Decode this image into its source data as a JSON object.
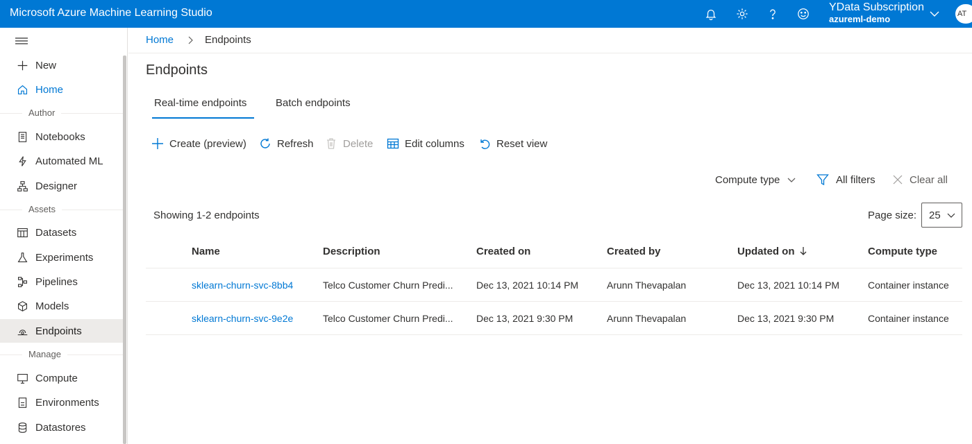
{
  "app": {
    "title": "Microsoft Azure Machine Learning Studio",
    "subscription": "YData Subscription",
    "workspace": "azureml-demo",
    "avatar_initials": "AT",
    "brand_color": "#0078d4"
  },
  "header_icons": [
    "bell-icon",
    "gear-icon",
    "help-icon",
    "smiley-icon"
  ],
  "sidebar": {
    "new_label": "New",
    "home_label": "Home",
    "sections": {
      "author": "Author",
      "assets": "Assets",
      "manage": "Manage"
    },
    "items": {
      "notebooks": "Notebooks",
      "automated_ml": "Automated ML",
      "designer": "Designer",
      "datasets": "Datasets",
      "experiments": "Experiments",
      "pipelines": "Pipelines",
      "models": "Models",
      "endpoints": "Endpoints",
      "compute": "Compute",
      "environments": "Environments",
      "datastores": "Datastores"
    },
    "active_item": "Endpoints"
  },
  "breadcrumb": {
    "home": "Home",
    "current": "Endpoints"
  },
  "page": {
    "title": "Endpoints",
    "tabs": {
      "realtime": "Real-time endpoints",
      "batch": "Batch endpoints"
    },
    "active_tab": "Real-time endpoints"
  },
  "toolbar": {
    "create": "Create (preview)",
    "refresh": "Refresh",
    "delete": "Delete",
    "edit_columns": "Edit columns",
    "reset_view": "Reset view"
  },
  "filters": {
    "compute_type": "Compute type",
    "all_filters": "All filters",
    "clear_all": "Clear all"
  },
  "list": {
    "showing": "Showing 1-2 endpoints",
    "page_size_label": "Page size:",
    "page_size": "25"
  },
  "table": {
    "columns": {
      "name": "Name",
      "description": "Description",
      "created_on": "Created on",
      "created_by": "Created by",
      "updated_on": "Updated on",
      "compute_type": "Compute type"
    },
    "sorted_column": "Updated on",
    "rows": [
      {
        "name": "sklearn-churn-svc-8bb4",
        "description": "Telco Customer Churn Predi...",
        "created_on": "Dec 13, 2021 10:14 PM",
        "created_by": "Arunn Thevapalan",
        "updated_on": "Dec 13, 2021 10:14 PM",
        "compute_type": "Container instance"
      },
      {
        "name": "sklearn-churn-svc-9e2e",
        "description": "Telco Customer Churn Predi...",
        "created_on": "Dec 13, 2021 9:30 PM",
        "created_by": "Arunn Thevapalan",
        "updated_on": "Dec 13, 2021 9:30 PM",
        "compute_type": "Container instance"
      }
    ]
  }
}
